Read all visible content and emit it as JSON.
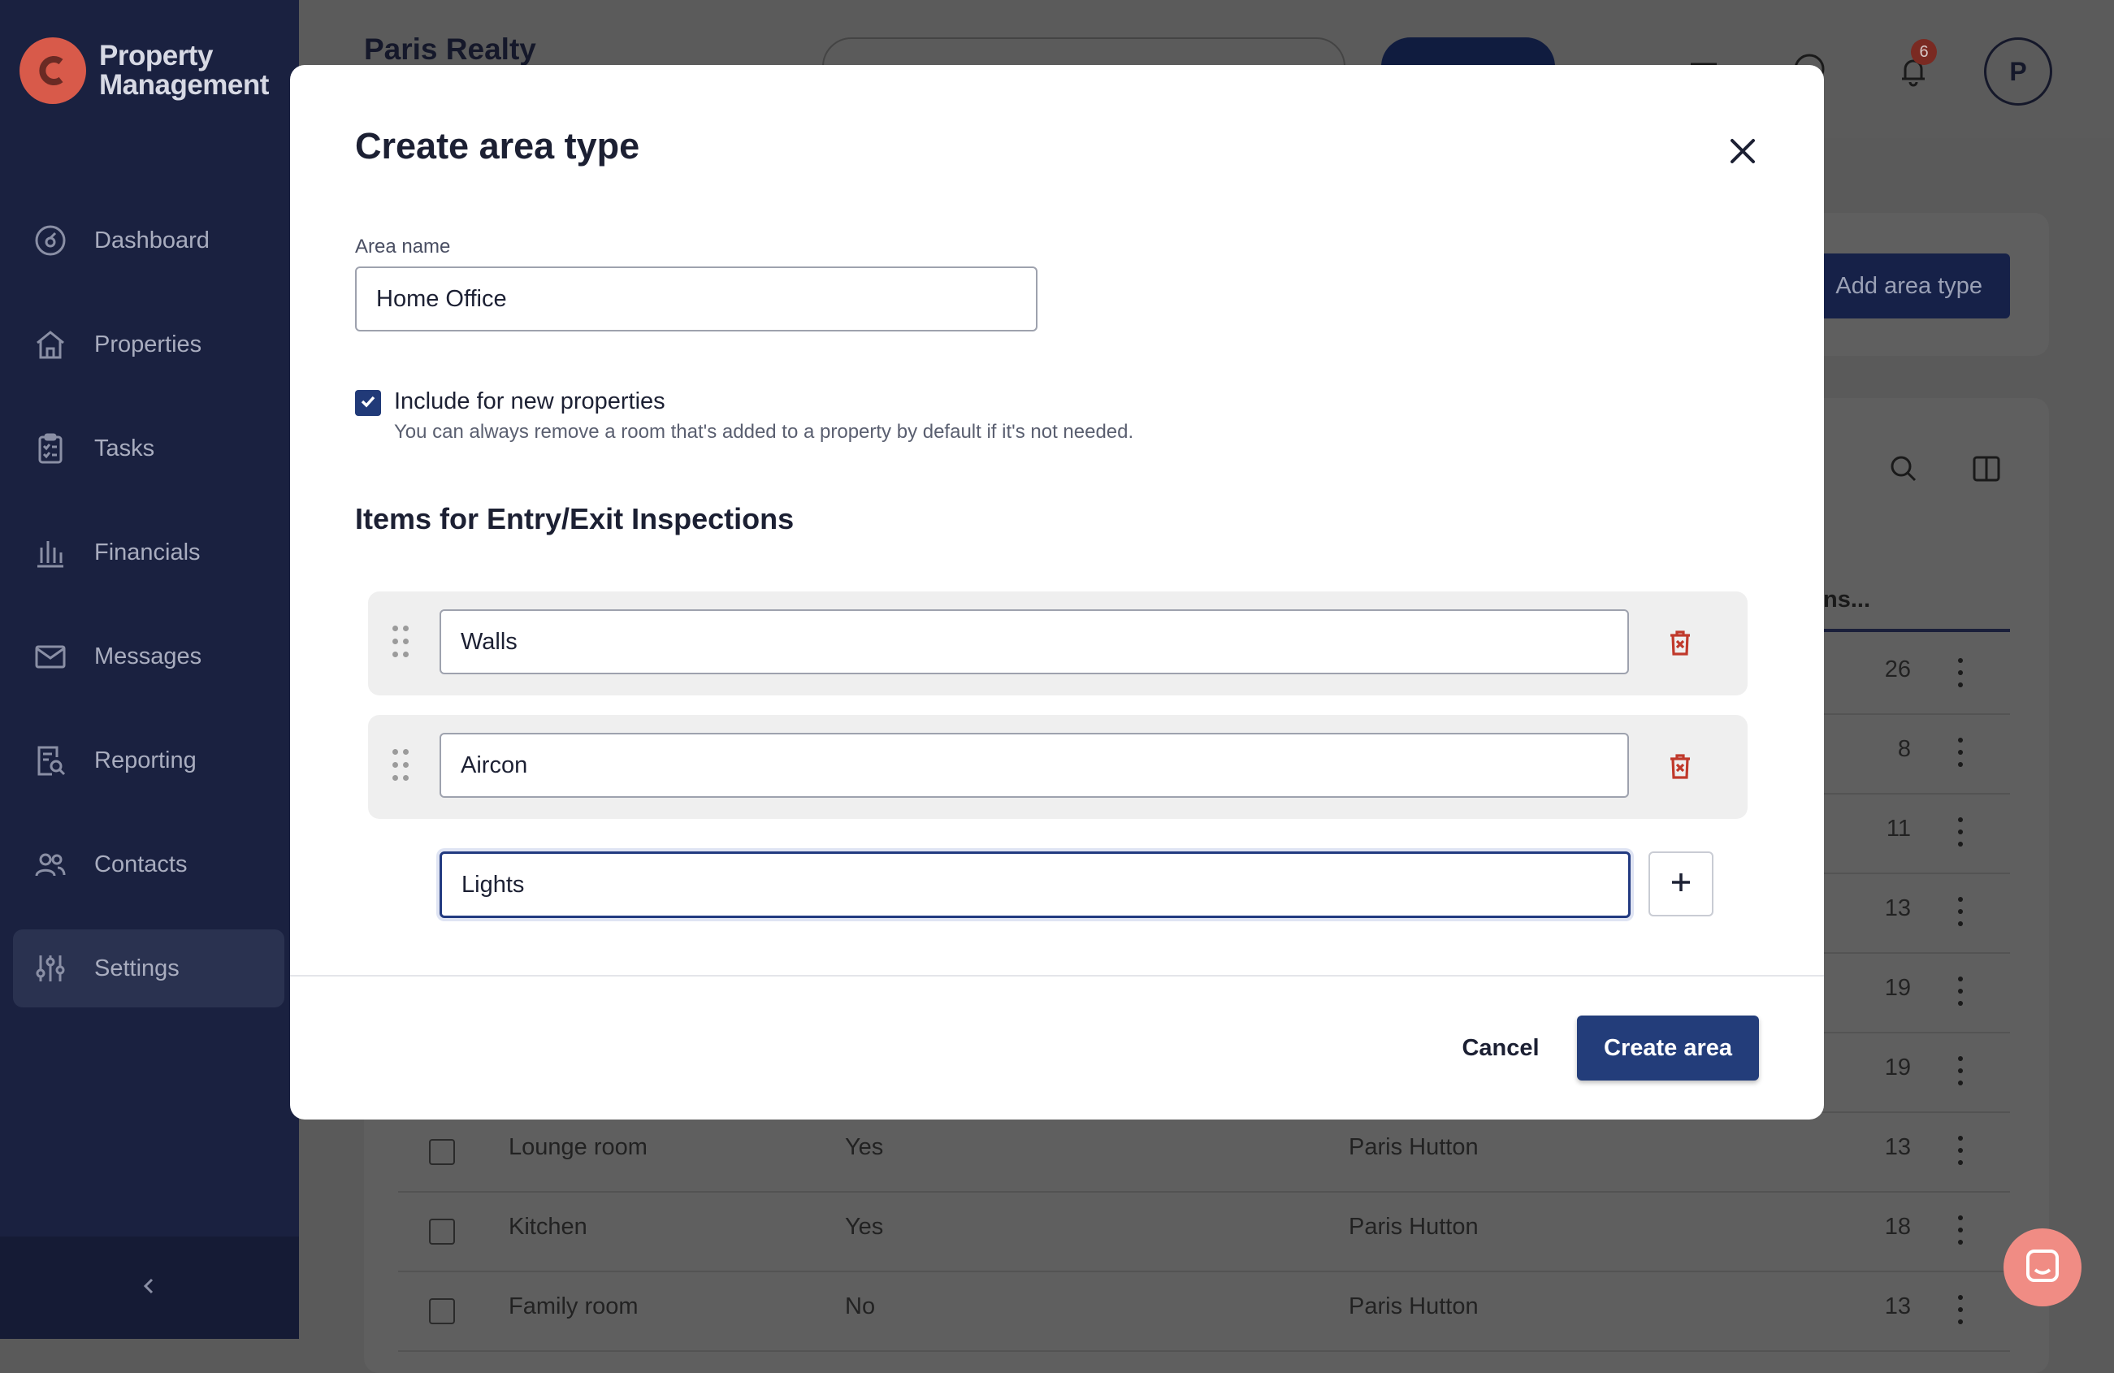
{
  "sidebar": {
    "logo_line1": "Property",
    "logo_line2": "Management",
    "items": [
      {
        "label": "Dashboard",
        "icon": "dashboard-icon"
      },
      {
        "label": "Properties",
        "icon": "home-icon"
      },
      {
        "label": "Tasks",
        "icon": "clipboard-icon"
      },
      {
        "label": "Financials",
        "icon": "bank-icon"
      },
      {
        "label": "Messages",
        "icon": "mail-icon"
      },
      {
        "label": "Reporting",
        "icon": "report-search-icon"
      },
      {
        "label": "Contacts",
        "icon": "users-icon"
      },
      {
        "label": "Settings",
        "icon": "sliders-icon",
        "active": true
      }
    ]
  },
  "header": {
    "company": "Paris Realty",
    "notification_count": "6",
    "avatar_initial": "P"
  },
  "page": {
    "add_area_type_label": "Add area type",
    "column_header_partial": "ns...",
    "table_rows": [
      {
        "name": "",
        "included": "",
        "owner": "",
        "items": "26"
      },
      {
        "name": "",
        "included": "",
        "owner": "",
        "items": "8"
      },
      {
        "name": "",
        "included": "",
        "owner": "",
        "items": "11"
      },
      {
        "name": "",
        "included": "",
        "owner": "",
        "items": "13"
      },
      {
        "name": "",
        "included": "",
        "owner": "",
        "items": "19"
      },
      {
        "name": "",
        "included": "",
        "owner": "",
        "items": "19"
      },
      {
        "name": "Lounge room",
        "included": "Yes",
        "owner": "Paris Hutton",
        "items": "13"
      },
      {
        "name": "Kitchen",
        "included": "Yes",
        "owner": "Paris Hutton",
        "items": "18"
      },
      {
        "name": "Family room",
        "included": "No",
        "owner": "Paris Hutton",
        "items": "13"
      }
    ]
  },
  "modal": {
    "title": "Create area type",
    "area_name_label": "Area name",
    "area_name_value": "Home Office",
    "include_checked": true,
    "include_label": "Include for new properties",
    "include_help": "You can always remove a room that's added to a property by default if it's not needed.",
    "items_section_title": "Items for Entry/Exit Inspections",
    "items": [
      {
        "value": "Walls"
      },
      {
        "value": "Aircon"
      }
    ],
    "new_item_value": "Lights",
    "cancel_label": "Cancel",
    "create_label": "Create area"
  },
  "colors": {
    "sidebar_bg": "#1a2140",
    "primary": "#233d7a",
    "danger": "#c0392b",
    "brand": "#d85a4a"
  }
}
